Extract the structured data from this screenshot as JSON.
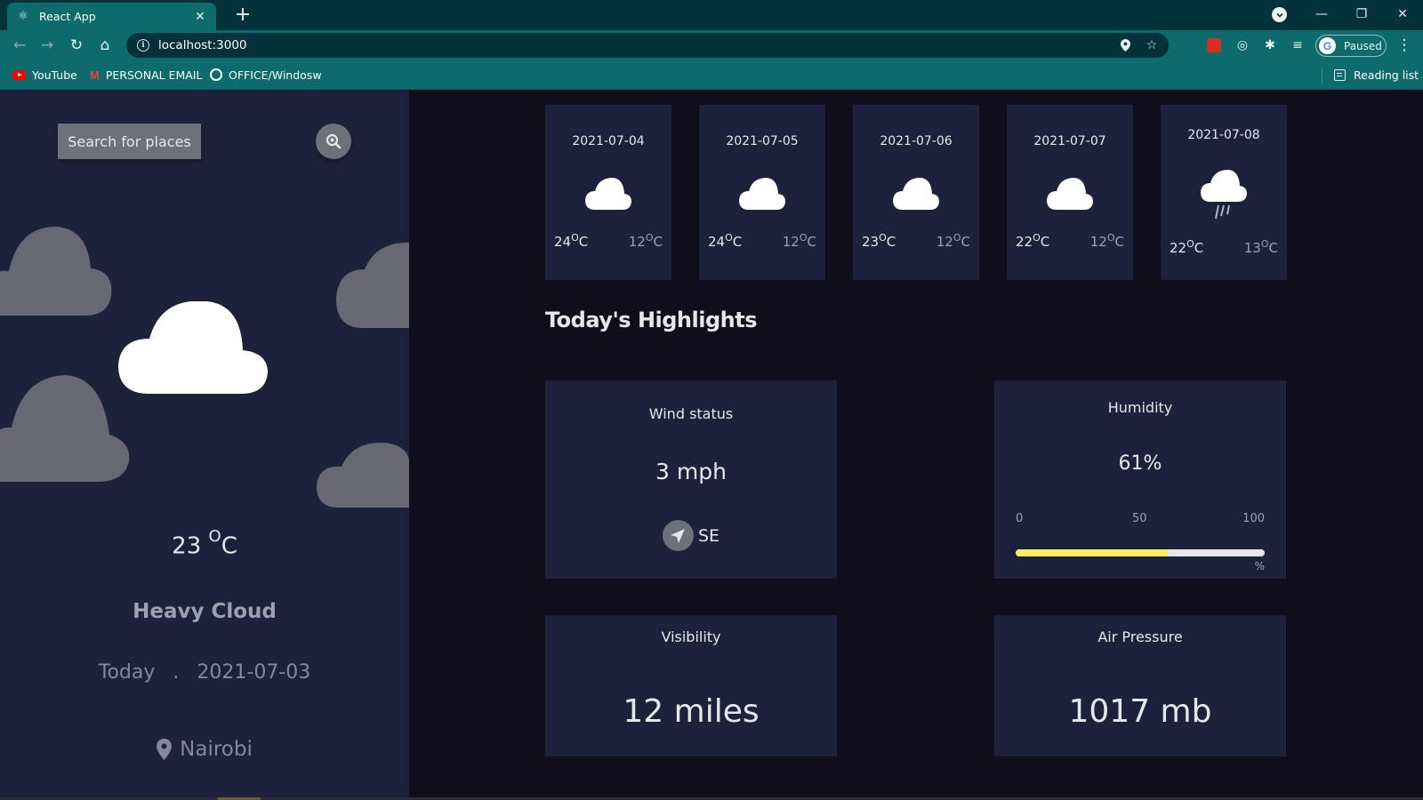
{
  "browser": {
    "tab_title": "React App",
    "url": "localhost:3000",
    "profile_status": "Paused",
    "bookmarks": [
      {
        "label": "YouTube",
        "icon": "youtube-icon"
      },
      {
        "label": "PERSONAL EMAIL",
        "icon": "gmail-icon"
      },
      {
        "label": "OFFICE/Windosw",
        "icon": "globe-icon"
      }
    ],
    "reading_list": "Reading list"
  },
  "sidebar": {
    "search_label": "Search for places",
    "temperature": "23 ",
    "temperature_unit": "O",
    "temperature_scale": "C",
    "condition": "Heavy Cloud",
    "day_label": "Today",
    "date_separator": ".",
    "date": "2021-07-03",
    "location": "Nairobi"
  },
  "forecast": [
    {
      "date": "2021-07-04",
      "max": "24",
      "min": "12",
      "unit": "O",
      "scale": "C",
      "icon": "cloud-icon"
    },
    {
      "date": "2021-07-05",
      "max": "24",
      "min": "12",
      "unit": "O",
      "scale": "C",
      "icon": "cloud-icon"
    },
    {
      "date": "2021-07-06",
      "max": "23",
      "min": "12",
      "unit": "O",
      "scale": "C",
      "icon": "cloud-icon"
    },
    {
      "date": "2021-07-07",
      "max": "22",
      "min": "12",
      "unit": "O",
      "scale": "C",
      "icon": "cloud-icon"
    },
    {
      "date": "2021-07-08",
      "max": "22",
      "min": "13",
      "unit": "O",
      "scale": "C",
      "icon": "rain-cloud-icon"
    }
  ],
  "highlights": {
    "title": "Today's Highlights",
    "wind": {
      "label": "Wind status",
      "value": "3 mph",
      "direction": "SE"
    },
    "humidity": {
      "label": "Humidity",
      "value": "61%",
      "percent": 61,
      "scale_min": "0",
      "scale_mid": "50",
      "scale_max": "100",
      "unit": "%"
    },
    "visibility": {
      "label": "Visibility",
      "value": "12 miles"
    },
    "pressure": {
      "label": "Air Pressure",
      "value": "1017 mb"
    }
  },
  "colors": {
    "sidebar_bg": "#1e213a",
    "main_bg": "#100e1d",
    "card_bg": "#1e213a",
    "humidity_bar": "#ffec65",
    "chrome_teal": "#0d6b6e"
  }
}
